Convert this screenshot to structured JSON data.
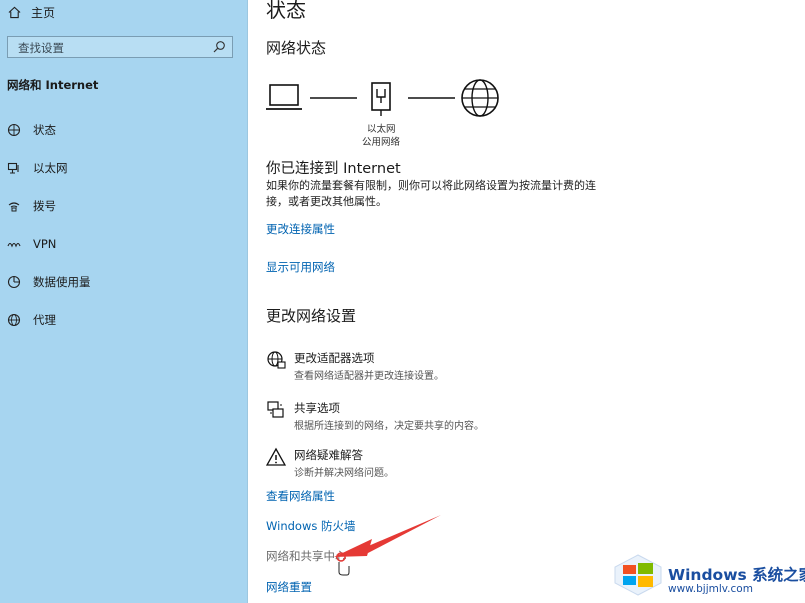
{
  "sidebar": {
    "home_label": "主页",
    "search_placeholder": "查找设置",
    "section_title": "网络和 Internet",
    "items": [
      {
        "label": "状态",
        "icon": "home-status-icon"
      },
      {
        "label": "以太网",
        "icon": "ethernet-icon"
      },
      {
        "label": "拨号",
        "icon": "dialup-icon"
      },
      {
        "label": "VPN",
        "icon": "vpn-icon"
      },
      {
        "label": "数据使用量",
        "icon": "data-usage-icon"
      },
      {
        "label": "代理",
        "icon": "globe-icon"
      }
    ]
  },
  "main": {
    "title": "状态",
    "network_status": "网络状态",
    "diagram": {
      "adapter_name": "以太网",
      "network_type": "公用网络"
    },
    "connected_heading": "你已连接到 Internet",
    "connected_desc": "如果你的流量套餐有限制，则你可以将此网络设置为按流量计费的连接，或者更改其他属性。",
    "link_change_props": "更改连接属性",
    "link_show_networks": "显示可用网络",
    "change_settings_heading": "更改网络设置",
    "options": [
      {
        "title": "更改适配器选项",
        "desc": "查看网络适配器并更改连接设置。",
        "icon": "adapter-icon"
      },
      {
        "title": "共享选项",
        "desc": "根据所连接到的网络，决定要共享的内容。",
        "icon": "sharing-icon"
      },
      {
        "title": "网络疑难解答",
        "desc": "诊断并解决网络问题。",
        "icon": "warning-icon"
      }
    ],
    "link_view_props": "查看网络属性",
    "link_firewall": "Windows 防火墙",
    "link_sharing_center": "网络和共享中心",
    "link_reset": "网络重置"
  },
  "watermark": {
    "brand": "Windows 系统之家",
    "url": "www.bjjmlv.com"
  },
  "colors": {
    "sidebar_bg": "#a7d5f0",
    "link": "#0063b1",
    "arrow": "#e53935"
  }
}
